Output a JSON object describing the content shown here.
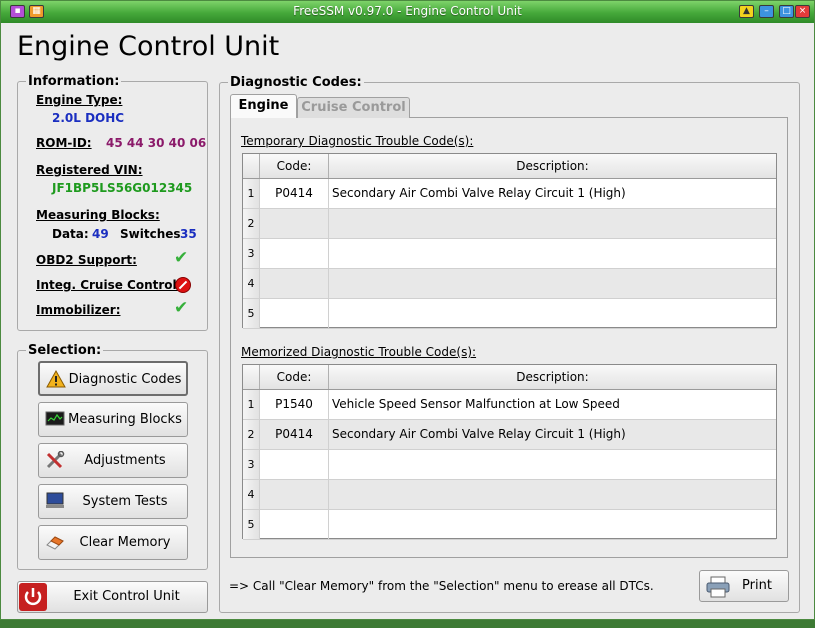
{
  "window": {
    "title": "FreeSSM v0.97.0 - Engine Control Unit"
  },
  "page_title": "Engine Control Unit",
  "information": {
    "title": "Information:",
    "engine_type_label": "Engine Type:",
    "engine_type": "2.0L DOHC",
    "rom_id_label": "ROM-ID:",
    "rom_id": "45 44 30 40 06",
    "vin_label": "Registered VIN:",
    "vin": "JF1BP5LS56G012345",
    "measuring_blocks_label": "Measuring Blocks:",
    "data_label": "Data:",
    "data_count": "49",
    "switches_label": "Switches",
    "switches_count": "35",
    "obd2_label": "OBD2 Support:",
    "cruise_label": "Integ. Cruise Control:",
    "immobilizer_label": "Immobilizer:"
  },
  "selection": {
    "title": "Selection:",
    "diagnostic_codes": "Diagnostic Codes",
    "measuring_blocks": "Measuring Blocks",
    "adjustments": "Adjustments",
    "system_tests": "System Tests",
    "clear_memory": "Clear Memory"
  },
  "exit_button": "Exit Control Unit",
  "diagnostic": {
    "title": "Diagnostic Codes:",
    "tab_engine": "Engine",
    "tab_cruise": "Cruise Control",
    "temporary_caption": "Temporary Diagnostic Trouble Code(s):",
    "memorized_caption": "Memorized Diagnostic Trouble Code(s):",
    "col_code": "Code:",
    "col_desc": "Description:",
    "temporary_rows": [
      {
        "num": "1",
        "code": "P0414",
        "desc": "Secondary Air Combi Valve Relay Circuit 1 (High)"
      },
      {
        "num": "2",
        "code": "",
        "desc": ""
      },
      {
        "num": "3",
        "code": "",
        "desc": ""
      },
      {
        "num": "4",
        "code": "",
        "desc": ""
      },
      {
        "num": "5",
        "code": "",
        "desc": ""
      }
    ],
    "memorized_rows": [
      {
        "num": "1",
        "code": "P1540",
        "desc": "Vehicle Speed Sensor Malfunction at Low Speed"
      },
      {
        "num": "2",
        "code": "P0414",
        "desc": "Secondary Air Combi Valve Relay Circuit 1 (High)"
      },
      {
        "num": "3",
        "code": "",
        "desc": ""
      },
      {
        "num": "4",
        "code": "",
        "desc": ""
      },
      {
        "num": "5",
        "code": "",
        "desc": ""
      }
    ],
    "hint": "=> Call \"Clear Memory\" from the \"Selection\" menu to erease all DTCs.",
    "print_label": "Print"
  }
}
